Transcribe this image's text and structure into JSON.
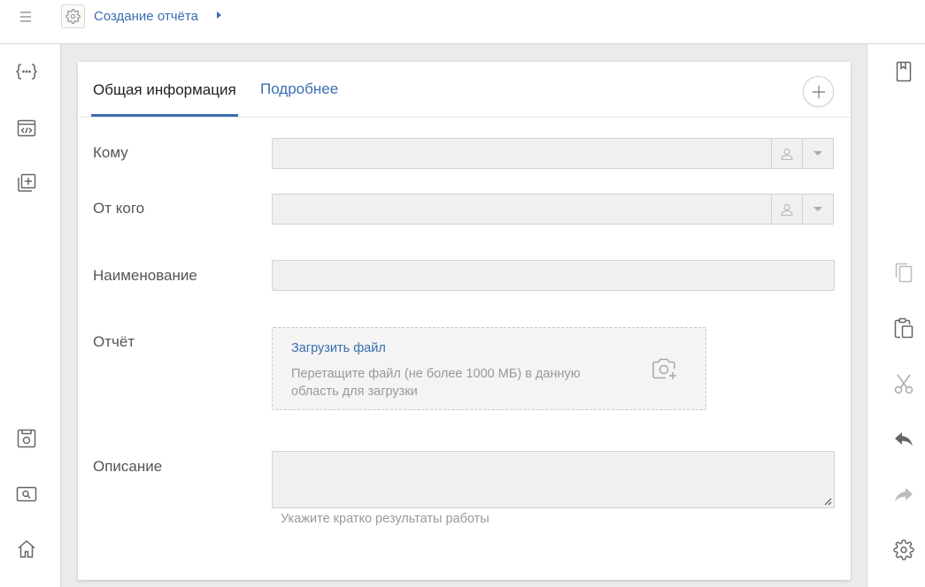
{
  "header": {
    "title": "Создание отчёта"
  },
  "tabs": [
    {
      "label": "Общая информация",
      "active": true
    },
    {
      "label": "Подробнее",
      "active": false
    }
  ],
  "form": {
    "to": {
      "label": "Кому",
      "value": ""
    },
    "from": {
      "label": "От кого",
      "value": ""
    },
    "name": {
      "label": "Наименование",
      "value": ""
    },
    "report": {
      "label": "Отчёт",
      "upload_link": "Загрузить файл",
      "upload_hint": "Перетащите файл (не более 1000 МБ) в данную область для загрузки"
    },
    "description": {
      "label": "Описание",
      "value": "",
      "hint": "Укажите кратко результаты работы"
    }
  },
  "left_rail": [
    "braces-icon",
    "code-window-icon",
    "add-copy-icon",
    "save-icon",
    "search-window-icon",
    "home-icon"
  ],
  "right_rail": [
    "bookmark-icon",
    "copy-icon",
    "paste-icon",
    "cut-icon",
    "undo-icon",
    "redo-icon",
    "settings-icon"
  ],
  "colors": {
    "accent": "#3b6db3",
    "rail_icon": "#666666",
    "disabled_icon": "#bbbbbb"
  }
}
